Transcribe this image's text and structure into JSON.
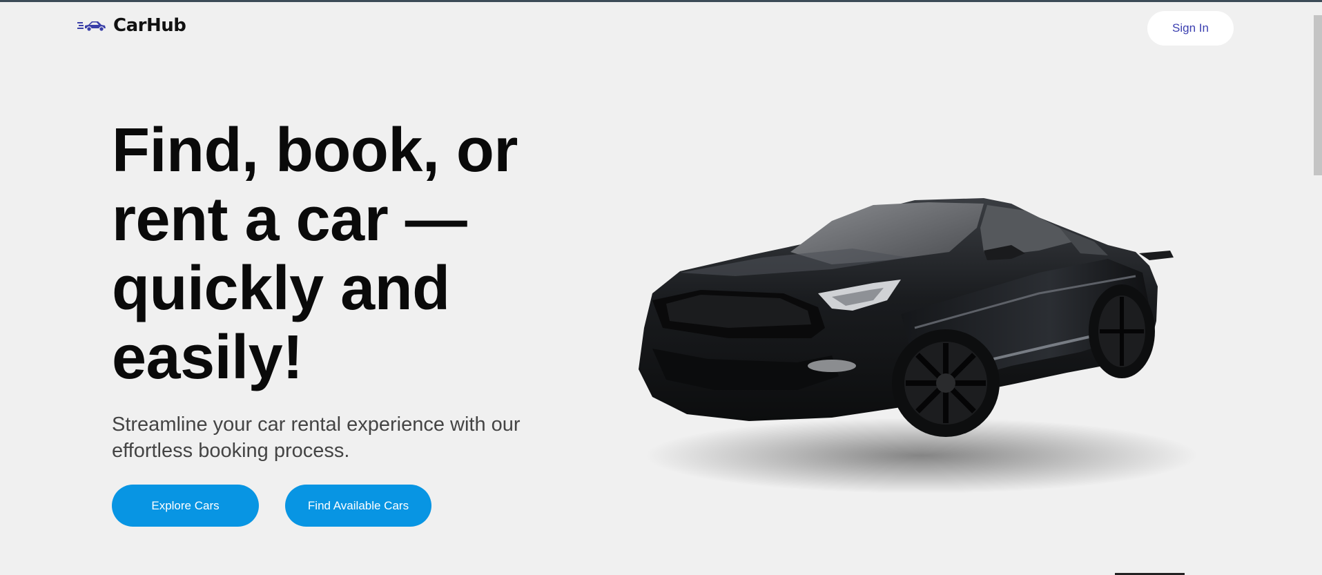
{
  "brand": {
    "name": "CarHub",
    "logo_icon": "car-speed-icon"
  },
  "nav": {
    "signin_label": "Sign In"
  },
  "hero": {
    "title": "Find, book, or rent a car — quickly and easily!",
    "subtitle": "Streamline your car rental experience with our effortless booking process.",
    "buttons": [
      {
        "label": "Explore Cars"
      },
      {
        "label": "Find Available Cars"
      }
    ],
    "image": "black-sports-car"
  },
  "colors": {
    "background": "#f0f0f0",
    "accent": "#0895e3",
    "brand_blue": "#3b3fb0"
  }
}
